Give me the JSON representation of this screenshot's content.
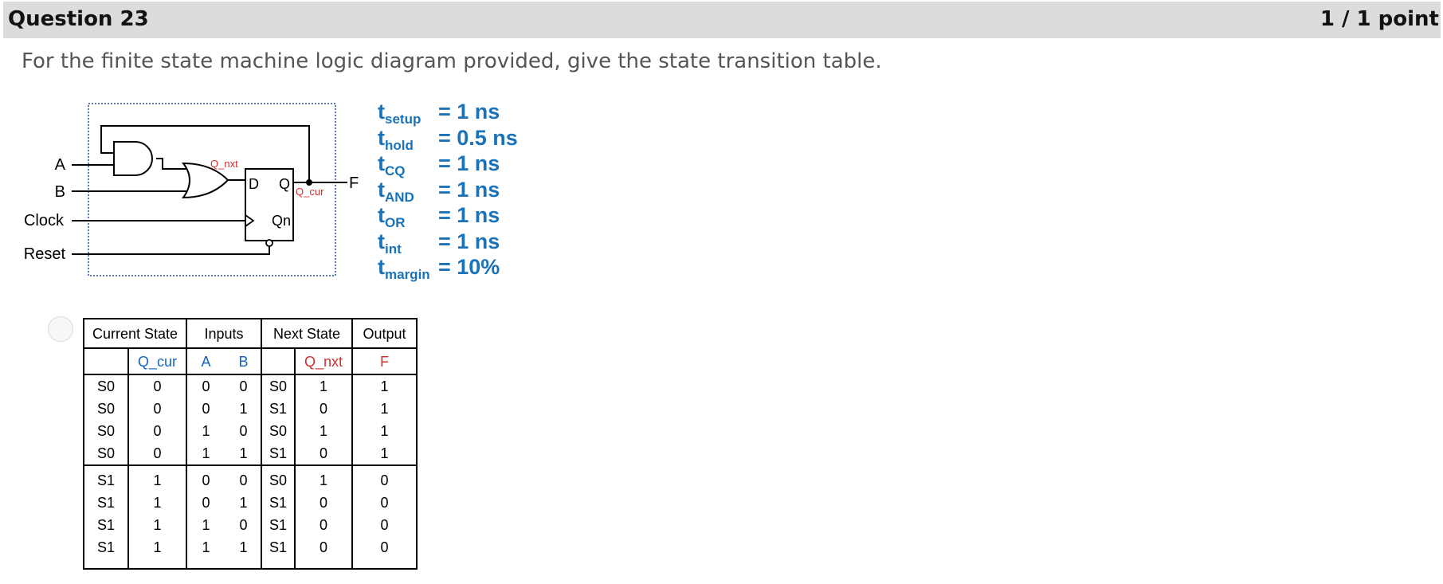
{
  "question": {
    "title": "Question 23",
    "points": "1 / 1 point",
    "text": "For the finite state machine logic diagram provided, give the state transition table."
  },
  "circuit": {
    "inputs": [
      "A",
      "B",
      "Clock",
      "Reset"
    ],
    "output": "F",
    "ff_d": "D",
    "ff_q": "Q",
    "ff_qn": "Qn",
    "net_q_nxt": "Q_nxt",
    "net_q_cur": "Q_cur"
  },
  "timing": [
    {
      "sym": "t",
      "sub": "setup",
      "value": "= 1 ns"
    },
    {
      "sym": "t",
      "sub": "hold",
      "value": "= 0.5 ns"
    },
    {
      "sym": "t",
      "sub": "CQ",
      "value": "= 1 ns"
    },
    {
      "sym": "t",
      "sub": "AND",
      "value": "= 1 ns"
    },
    {
      "sym": "t",
      "sub": "OR",
      "value": "= 1 ns"
    },
    {
      "sym": "t",
      "sub": "int",
      "value": "= 1 ns"
    },
    {
      "sym": "t",
      "sub": "margin",
      "value": "= 10%"
    }
  ],
  "table": {
    "groups": [
      "Current State",
      "Inputs",
      "Next State",
      "Output"
    ],
    "subheaders": [
      "",
      "Q_cur",
      "A",
      "B",
      "",
      "Q_nxt",
      "F"
    ],
    "rows": [
      [
        "S0",
        "0",
        "0",
        "0",
        "S0",
        "1",
        "1"
      ],
      [
        "S0",
        "0",
        "0",
        "1",
        "S1",
        "0",
        "1"
      ],
      [
        "S0",
        "0",
        "1",
        "0",
        "S0",
        "1",
        "1"
      ],
      [
        "S0",
        "0",
        "1",
        "1",
        "S1",
        "0",
        "1"
      ],
      [
        "S1",
        "1",
        "0",
        "0",
        "S0",
        "1",
        "0"
      ],
      [
        "S1",
        "1",
        "0",
        "1",
        "S1",
        "0",
        "0"
      ],
      [
        "S1",
        "1",
        "1",
        "0",
        "S1",
        "0",
        "0"
      ],
      [
        "S1",
        "1",
        "1",
        "1",
        "S1",
        "0",
        "0"
      ]
    ]
  },
  "colors": {
    "timing_blue": "#1a73b8",
    "table_blue": "#1565c0",
    "red": "#d32f2f",
    "dotted_border": "#1e50a0"
  }
}
